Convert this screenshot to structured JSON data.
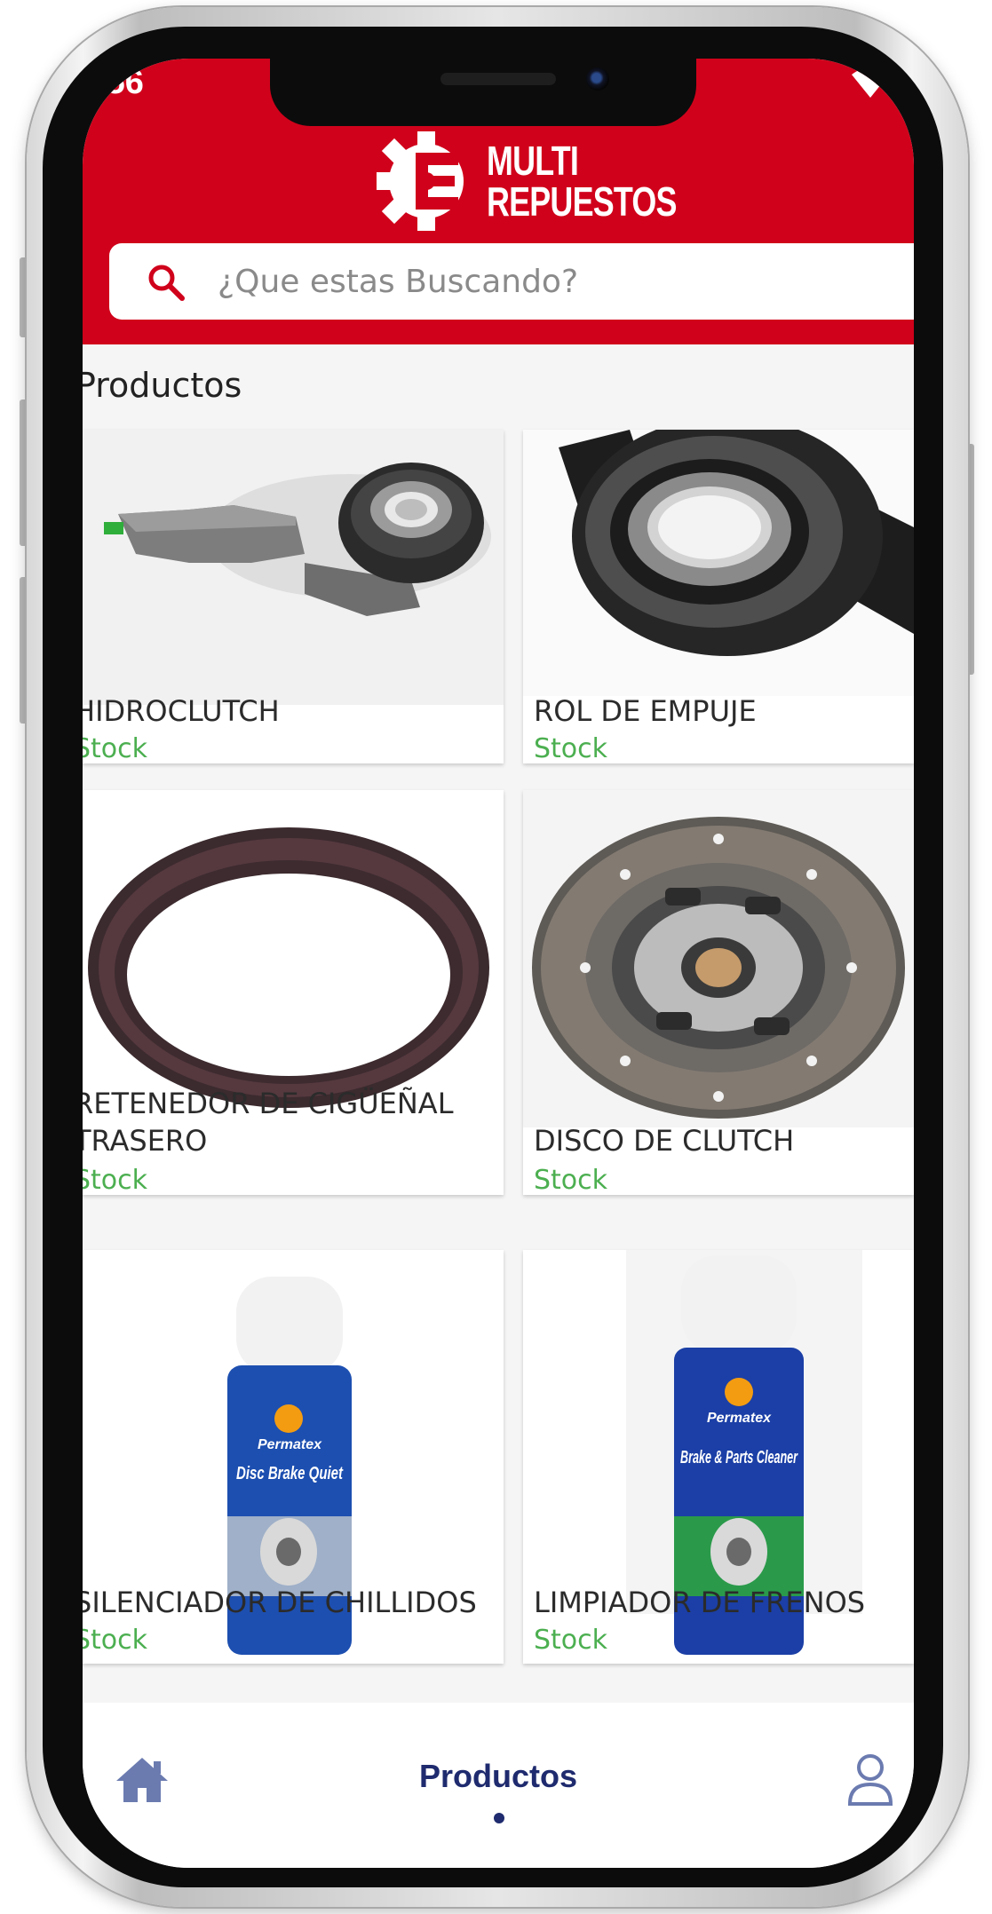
{
  "status_bar": {
    "time": ":56"
  },
  "brand": {
    "line1": "MULTI",
    "line2": "REPUESTOS"
  },
  "search": {
    "placeholder": "¿Que estas Buscando?"
  },
  "section": {
    "title": "Productos"
  },
  "products": [
    {
      "name": "HIDROCLUTCH",
      "stock": "Stock"
    },
    {
      "name": "ROL DE EMPUJE",
      "stock": "Stock"
    },
    {
      "name": "RETENEDOR DE CIGÜEÑAL",
      "name_line2": "TRASERO",
      "stock": "Stock"
    },
    {
      "name": "DISCO DE CLUTCH",
      "stock": "Stock"
    },
    {
      "name": "SILENCIADOR DE CHILLIDOS",
      "stock": "Stock",
      "can_brand": "Permatex",
      "can_title": "Disc Brake Quiet"
    },
    {
      "name": "LIMPIADOR DE FRENOS",
      "stock": "Stock",
      "can_brand": "Permatex",
      "can_title": "Brake & Parts Cleaner"
    }
  ],
  "bottom_nav": {
    "active_label": "Productos",
    "home_icon": "home-icon",
    "user_icon": "user-icon"
  },
  "colors": {
    "brand_red": "#d0021b",
    "stock_green": "#4caf50",
    "nav_blue": "#1f2b6e"
  }
}
